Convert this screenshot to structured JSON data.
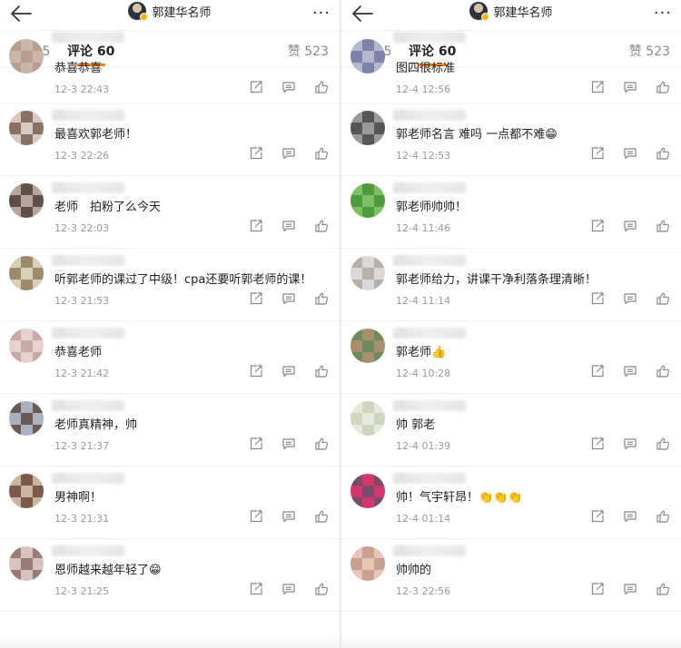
{
  "colors": {
    "accent": "#ff8200",
    "time": "#999999"
  },
  "panels": [
    {
      "header": {
        "title": "郭建华名师",
        "more": "···"
      },
      "tabs": {
        "repost": "转发 5",
        "comment": "评论 60",
        "like": "赞 523"
      },
      "comments": [
        {
          "text": "恭喜恭喜",
          "time": "12-3 22:43"
        },
        {
          "text": "最喜欢郭老师！",
          "time": "12-3 22:26"
        },
        {
          "text": "老师　拍粉了么今天",
          "time": "12-3 22:03"
        },
        {
          "text": "听郭老师的课过了中级！cpa还要听郭老师的课！",
          "time": "12-3 21:53"
        },
        {
          "text": "恭喜老师",
          "time": "12-3 21:42"
        },
        {
          "text": "老师真精神，帅",
          "time": "12-3 21:37"
        },
        {
          "text": "男神啊！",
          "time": "12-3 21:31"
        },
        {
          "text": "恩师越来越年轻了😁",
          "time": "12-3 21:25"
        }
      ]
    },
    {
      "header": {
        "title": "郭建华名师",
        "more": "···"
      },
      "tabs": {
        "repost": "转发 5",
        "comment": "评论 60",
        "like": "赞 523"
      },
      "comments": [
        {
          "text": "图四很标准",
          "time": "12-4 12:56"
        },
        {
          "text": "郭老师名言 难吗 一点都不难😁",
          "time": "12-4 12:53"
        },
        {
          "text": "郭老师帅帅！",
          "time": "12-4 11:46"
        },
        {
          "text": "郭老师给力，讲课干净利落条理清晰！",
          "time": "12-4 11:14"
        },
        {
          "text": "郭老师👍",
          "time": "12-4 10:28"
        },
        {
          "text": "帅 郭老",
          "time": "12-4 01:39"
        },
        {
          "text": "帅！气宇轩昂！👏👏👏",
          "time": "12-4 01:14"
        },
        {
          "text": "帅帅的",
          "time": "12-3 22:56"
        }
      ]
    }
  ]
}
